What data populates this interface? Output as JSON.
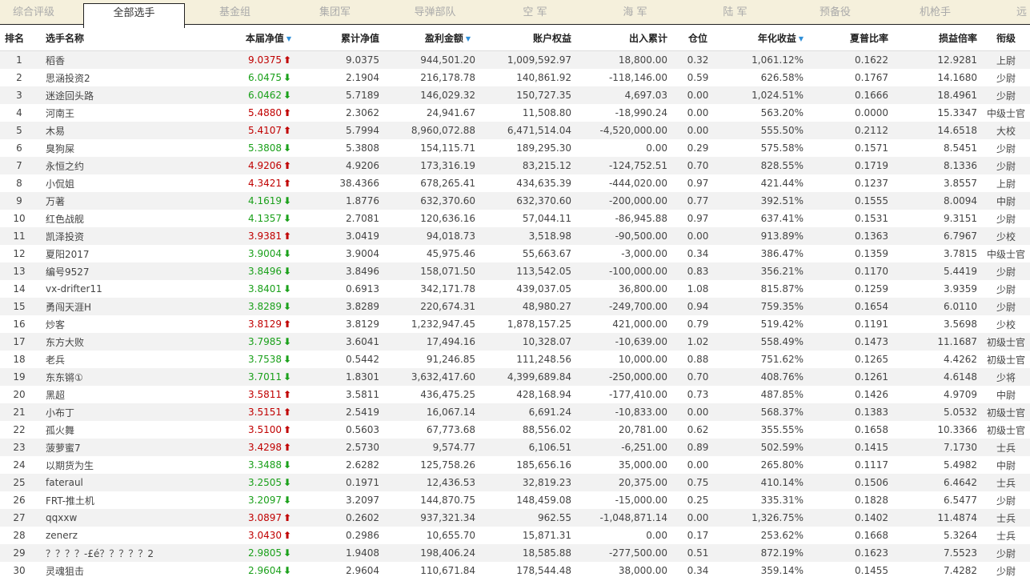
{
  "tabs": [
    {
      "label": "综合评级",
      "active": false
    },
    {
      "label": "全部选手",
      "active": true
    },
    {
      "label": "基金组",
      "active": false
    },
    {
      "label": "集团军",
      "active": false
    },
    {
      "label": "导弹部队",
      "active": false
    },
    {
      "label": "空  军",
      "active": false
    },
    {
      "label": "海  军",
      "active": false
    },
    {
      "label": "陆  军",
      "active": false
    },
    {
      "label": "预备役",
      "active": false
    },
    {
      "label": "机枪手",
      "active": false
    },
    {
      "label": "远",
      "active": false
    }
  ],
  "table": {
    "headers": [
      "排名",
      "选手名称",
      "本届净值",
      "累计净值",
      "盈利金额",
      "账户权益",
      "出入累计",
      "仓位",
      "年化收益",
      "夏普比率",
      "损益倍率",
      "衔级"
    ],
    "rows": [
      {
        "rank": "1",
        "name": "稻香",
        "nav": "9.0375",
        "dir": "up",
        "cum": "9.0375",
        "profit": "944,501.20",
        "equity": "1,009,592.97",
        "flow": "18,800.00",
        "pos": "0.32",
        "annual": "1,061.12%",
        "sharpe": "0.1622",
        "pl": "12.9281",
        "grade": "上尉"
      },
      {
        "rank": "2",
        "name": "思涵投资2",
        "nav": "6.0475",
        "dir": "down",
        "cum": "2.1904",
        "profit": "216,178.78",
        "equity": "140,861.92",
        "flow": "-118,146.00",
        "pos": "0.59",
        "annual": "626.58%",
        "sharpe": "0.1767",
        "pl": "14.1680",
        "grade": "少尉"
      },
      {
        "rank": "3",
        "name": "迷途回头路",
        "nav": "6.0462",
        "dir": "down",
        "cum": "5.7189",
        "profit": "146,029.32",
        "equity": "150,727.35",
        "flow": "4,697.03",
        "pos": "0.00",
        "annual": "1,024.51%",
        "sharpe": "0.1666",
        "pl": "18.4961",
        "grade": "少尉"
      },
      {
        "rank": "4",
        "name": "河南王",
        "nav": "5.4880",
        "dir": "up",
        "cum": "2.3062",
        "profit": "24,941.67",
        "equity": "11,508.80",
        "flow": "-18,990.24",
        "pos": "0.00",
        "annual": "563.20%",
        "sharpe": "0.0000",
        "pl": "15.3347",
        "grade": "中级士官"
      },
      {
        "rank": "5",
        "name": "木易",
        "nav": "5.4107",
        "dir": "up",
        "cum": "5.7994",
        "profit": "8,960,072.88",
        "equity": "6,471,514.04",
        "flow": "-4,520,000.00",
        "pos": "0.00",
        "annual": "555.50%",
        "sharpe": "0.2112",
        "pl": "14.6518",
        "grade": "大校"
      },
      {
        "rank": "6",
        "name": "臭狗屎",
        "nav": "5.3808",
        "dir": "down",
        "cum": "5.3808",
        "profit": "154,115.71",
        "equity": "189,295.30",
        "flow": "0.00",
        "pos": "0.29",
        "annual": "575.58%",
        "sharpe": "0.1571",
        "pl": "8.5451",
        "grade": "少尉"
      },
      {
        "rank": "7",
        "name": "永恒之约",
        "nav": "4.9206",
        "dir": "up",
        "cum": "4.9206",
        "profit": "173,316.19",
        "equity": "83,215.12",
        "flow": "-124,752.51",
        "pos": "0.70",
        "annual": "828.55%",
        "sharpe": "0.1719",
        "pl": "8.1336",
        "grade": "少尉"
      },
      {
        "rank": "8",
        "name": "小侃姐",
        "nav": "4.3421",
        "dir": "up",
        "cum": "38.4366",
        "profit": "678,265.41",
        "equity": "434,635.39",
        "flow": "-444,020.00",
        "pos": "0.97",
        "annual": "421.44%",
        "sharpe": "0.1237",
        "pl": "3.8557",
        "grade": "上尉"
      },
      {
        "rank": "9",
        "name": "万著",
        "nav": "4.1619",
        "dir": "down",
        "cum": "1.8776",
        "profit": "632,370.60",
        "equity": "632,370.60",
        "flow": "-200,000.00",
        "pos": "0.77",
        "annual": "392.51%",
        "sharpe": "0.1555",
        "pl": "8.0094",
        "grade": "中尉"
      },
      {
        "rank": "10",
        "name": "红色战舰",
        "nav": "4.1357",
        "dir": "down",
        "cum": "2.7081",
        "profit": "120,636.16",
        "equity": "57,044.11",
        "flow": "-86,945.88",
        "pos": "0.97",
        "annual": "637.41%",
        "sharpe": "0.1531",
        "pl": "9.3151",
        "grade": "少尉"
      },
      {
        "rank": "11",
        "name": "凯泽投资",
        "nav": "3.9381",
        "dir": "up",
        "cum": "3.0419",
        "profit": "94,018.73",
        "equity": "3,518.98",
        "flow": "-90,500.00",
        "pos": "0.00",
        "annual": "913.89%",
        "sharpe": "0.1363",
        "pl": "6.7967",
        "grade": "少校"
      },
      {
        "rank": "12",
        "name": "夏阳2017",
        "nav": "3.9004",
        "dir": "down",
        "cum": "3.9004",
        "profit": "45,975.46",
        "equity": "55,663.67",
        "flow": "-3,000.00",
        "pos": "0.34",
        "annual": "386.47%",
        "sharpe": "0.1359",
        "pl": "3.7815",
        "grade": "中级士官"
      },
      {
        "rank": "13",
        "name": "编号9527",
        "nav": "3.8496",
        "dir": "down",
        "cum": "3.8496",
        "profit": "158,071.50",
        "equity": "113,542.05",
        "flow": "-100,000.00",
        "pos": "0.83",
        "annual": "356.21%",
        "sharpe": "0.1170",
        "pl": "5.4419",
        "grade": "少尉"
      },
      {
        "rank": "14",
        "name": "vx-drifter11",
        "nav": "3.8401",
        "dir": "down",
        "cum": "0.6913",
        "profit": "342,171.78",
        "equity": "439,037.05",
        "flow": "36,800.00",
        "pos": "1.08",
        "annual": "815.87%",
        "sharpe": "0.1259",
        "pl": "3.9359",
        "grade": "少尉"
      },
      {
        "rank": "15",
        "name": "勇闯天涯H",
        "nav": "3.8289",
        "dir": "down",
        "cum": "3.8289",
        "profit": "220,674.31",
        "equity": "48,980.27",
        "flow": "-249,700.00",
        "pos": "0.94",
        "annual": "759.35%",
        "sharpe": "0.1654",
        "pl": "6.0110",
        "grade": "少尉"
      },
      {
        "rank": "16",
        "name": "炒客",
        "nav": "3.8129",
        "dir": "up",
        "cum": "3.8129",
        "profit": "1,232,947.45",
        "equity": "1,878,157.25",
        "flow": "421,000.00",
        "pos": "0.79",
        "annual": "519.42%",
        "sharpe": "0.1191",
        "pl": "3.5698",
        "grade": "少校"
      },
      {
        "rank": "17",
        "name": "东方大败",
        "nav": "3.7985",
        "dir": "down",
        "cum": "3.6041",
        "profit": "17,494.16",
        "equity": "10,328.07",
        "flow": "-10,639.00",
        "pos": "1.02",
        "annual": "558.49%",
        "sharpe": "0.1473",
        "pl": "11.1687",
        "grade": "初级士官"
      },
      {
        "rank": "18",
        "name": "老兵",
        "nav": "3.7538",
        "dir": "down",
        "cum": "0.5442",
        "profit": "91,246.85",
        "equity": "111,248.56",
        "flow": "10,000.00",
        "pos": "0.88",
        "annual": "751.62%",
        "sharpe": "0.1265",
        "pl": "4.4262",
        "grade": "初级士官"
      },
      {
        "rank": "19",
        "name": "东东锵①",
        "nav": "3.7011",
        "dir": "down",
        "cum": "1.8301",
        "profit": "3,632,417.60",
        "equity": "4,399,689.84",
        "flow": "-250,000.00",
        "pos": "0.70",
        "annual": "408.76%",
        "sharpe": "0.1261",
        "pl": "4.6148",
        "grade": "少将"
      },
      {
        "rank": "20",
        "name": "黑超",
        "nav": "3.5811",
        "dir": "up",
        "cum": "3.5811",
        "profit": "436,475.25",
        "equity": "428,168.94",
        "flow": "-177,410.00",
        "pos": "0.73",
        "annual": "487.85%",
        "sharpe": "0.1426",
        "pl": "4.9709",
        "grade": "中尉"
      },
      {
        "rank": "21",
        "name": "小布丁",
        "nav": "3.5151",
        "dir": "up",
        "cum": "2.5419",
        "profit": "16,067.14",
        "equity": "6,691.24",
        "flow": "-10,833.00",
        "pos": "0.00",
        "annual": "568.37%",
        "sharpe": "0.1383",
        "pl": "5.0532",
        "grade": "初级士官"
      },
      {
        "rank": "22",
        "name": "孤火舞",
        "nav": "3.5100",
        "dir": "up",
        "cum": "0.5603",
        "profit": "67,773.68",
        "equity": "88,556.02",
        "flow": "20,781.00",
        "pos": "0.62",
        "annual": "355.55%",
        "sharpe": "0.1658",
        "pl": "10.3366",
        "grade": "初级士官"
      },
      {
        "rank": "23",
        "name": "菠萝蜜7",
        "nav": "3.4298",
        "dir": "up",
        "cum": "2.5730",
        "profit": "9,574.77",
        "equity": "6,106.51",
        "flow": "-6,251.00",
        "pos": "0.89",
        "annual": "502.59%",
        "sharpe": "0.1415",
        "pl": "7.1730",
        "grade": "士兵"
      },
      {
        "rank": "24",
        "name": "以期货为生",
        "nav": "3.3488",
        "dir": "down",
        "cum": "2.6282",
        "profit": "125,758.26",
        "equity": "185,656.16",
        "flow": "35,000.00",
        "pos": "0.00",
        "annual": "265.80%",
        "sharpe": "0.1117",
        "pl": "5.4982",
        "grade": "中尉"
      },
      {
        "rank": "25",
        "name": "fateraul",
        "nav": "3.2505",
        "dir": "down",
        "cum": "0.1971",
        "profit": "12,436.53",
        "equity": "32,819.23",
        "flow": "20,375.00",
        "pos": "0.75",
        "annual": "410.14%",
        "sharpe": "0.1506",
        "pl": "6.4642",
        "grade": "士兵"
      },
      {
        "rank": "26",
        "name": "FRT-推土机",
        "nav": "3.2097",
        "dir": "down",
        "cum": "3.2097",
        "profit": "144,870.75",
        "equity": "148,459.08",
        "flow": "-15,000.00",
        "pos": "0.25",
        "annual": "335.31%",
        "sharpe": "0.1828",
        "pl": "6.5477",
        "grade": "少尉"
      },
      {
        "rank": "27",
        "name": "qqxxw",
        "nav": "3.0897",
        "dir": "up",
        "cum": "0.2602",
        "profit": "937,321.34",
        "equity": "962.55",
        "flow": "-1,048,871.14",
        "pos": "0.00",
        "annual": "1,326.75%",
        "sharpe": "0.1402",
        "pl": "11.4874",
        "grade": "士兵"
      },
      {
        "rank": "28",
        "name": "zenerz",
        "nav": "3.0430",
        "dir": "up",
        "cum": "0.2986",
        "profit": "10,655.70",
        "equity": "15,871.31",
        "flow": "0.00",
        "pos": "0.17",
        "annual": "253.62%",
        "sharpe": "0.1668",
        "pl": "5.3264",
        "grade": "士兵"
      },
      {
        "rank": "29",
        "name": "？？？？-£é？？？？？2",
        "nav": "2.9805",
        "dir": "down",
        "cum": "1.9408",
        "profit": "198,406.24",
        "equity": "18,585.88",
        "flow": "-277,500.00",
        "pos": "0.51",
        "annual": "872.19%",
        "sharpe": "0.1623",
        "pl": "7.5523",
        "grade": "少尉"
      },
      {
        "rank": "30",
        "name": "灵魂狙击",
        "nav": "2.9604",
        "dir": "down",
        "cum": "2.9604",
        "profit": "110,671.84",
        "equity": "178,544.48",
        "flow": "38,000.00",
        "pos": "0.34",
        "annual": "359.14%",
        "sharpe": "0.1455",
        "pl": "7.4282",
        "grade": "少尉"
      }
    ]
  },
  "colors": {
    "up": "#c00000",
    "down": "#1aa01a",
    "sort": "#2f8fd8",
    "tabbar": "#f5f0dc",
    "stripe": "#f2f2f2"
  }
}
